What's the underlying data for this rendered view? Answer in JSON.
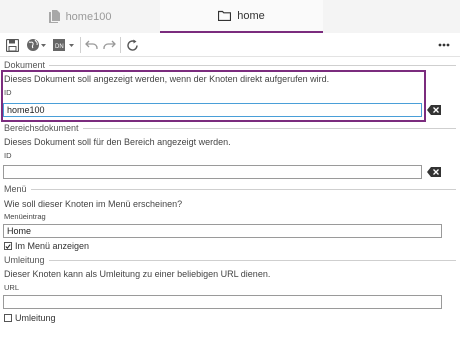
{
  "tabs": [
    {
      "label": "home100",
      "icon": "document-icon"
    },
    {
      "label": "home",
      "icon": "folder-icon"
    }
  ],
  "colors": {
    "accent": "#7b2c7e"
  },
  "sections": {
    "dokument": {
      "title": "Dokument",
      "description": "Dieses Dokument soll angezeigt werden, wenn der Knoten direkt aufgerufen wird.",
      "field_label": "ID",
      "field_value": "home100"
    },
    "bereich": {
      "title": "Bereichsdokument",
      "description": "Dieses Dokument soll für den Bereich angezeigt werden.",
      "field_label": "ID",
      "field_value": ""
    },
    "menu": {
      "title": "Menü",
      "description": "Wie soll dieser Knoten im Menü erscheinen?",
      "field_label": "Menüeintrag",
      "field_value": "Home",
      "checkbox_label": "Im Menü anzeigen",
      "checkbox_checked": true
    },
    "umleitung": {
      "title": "Umleitung",
      "description": "Dieser Knoten kann als Umleitung zu einer beliebigen URL dienen.",
      "field_label": "URL",
      "field_value": "",
      "checkbox_label": "Umleitung",
      "checkbox_checked": false
    }
  }
}
